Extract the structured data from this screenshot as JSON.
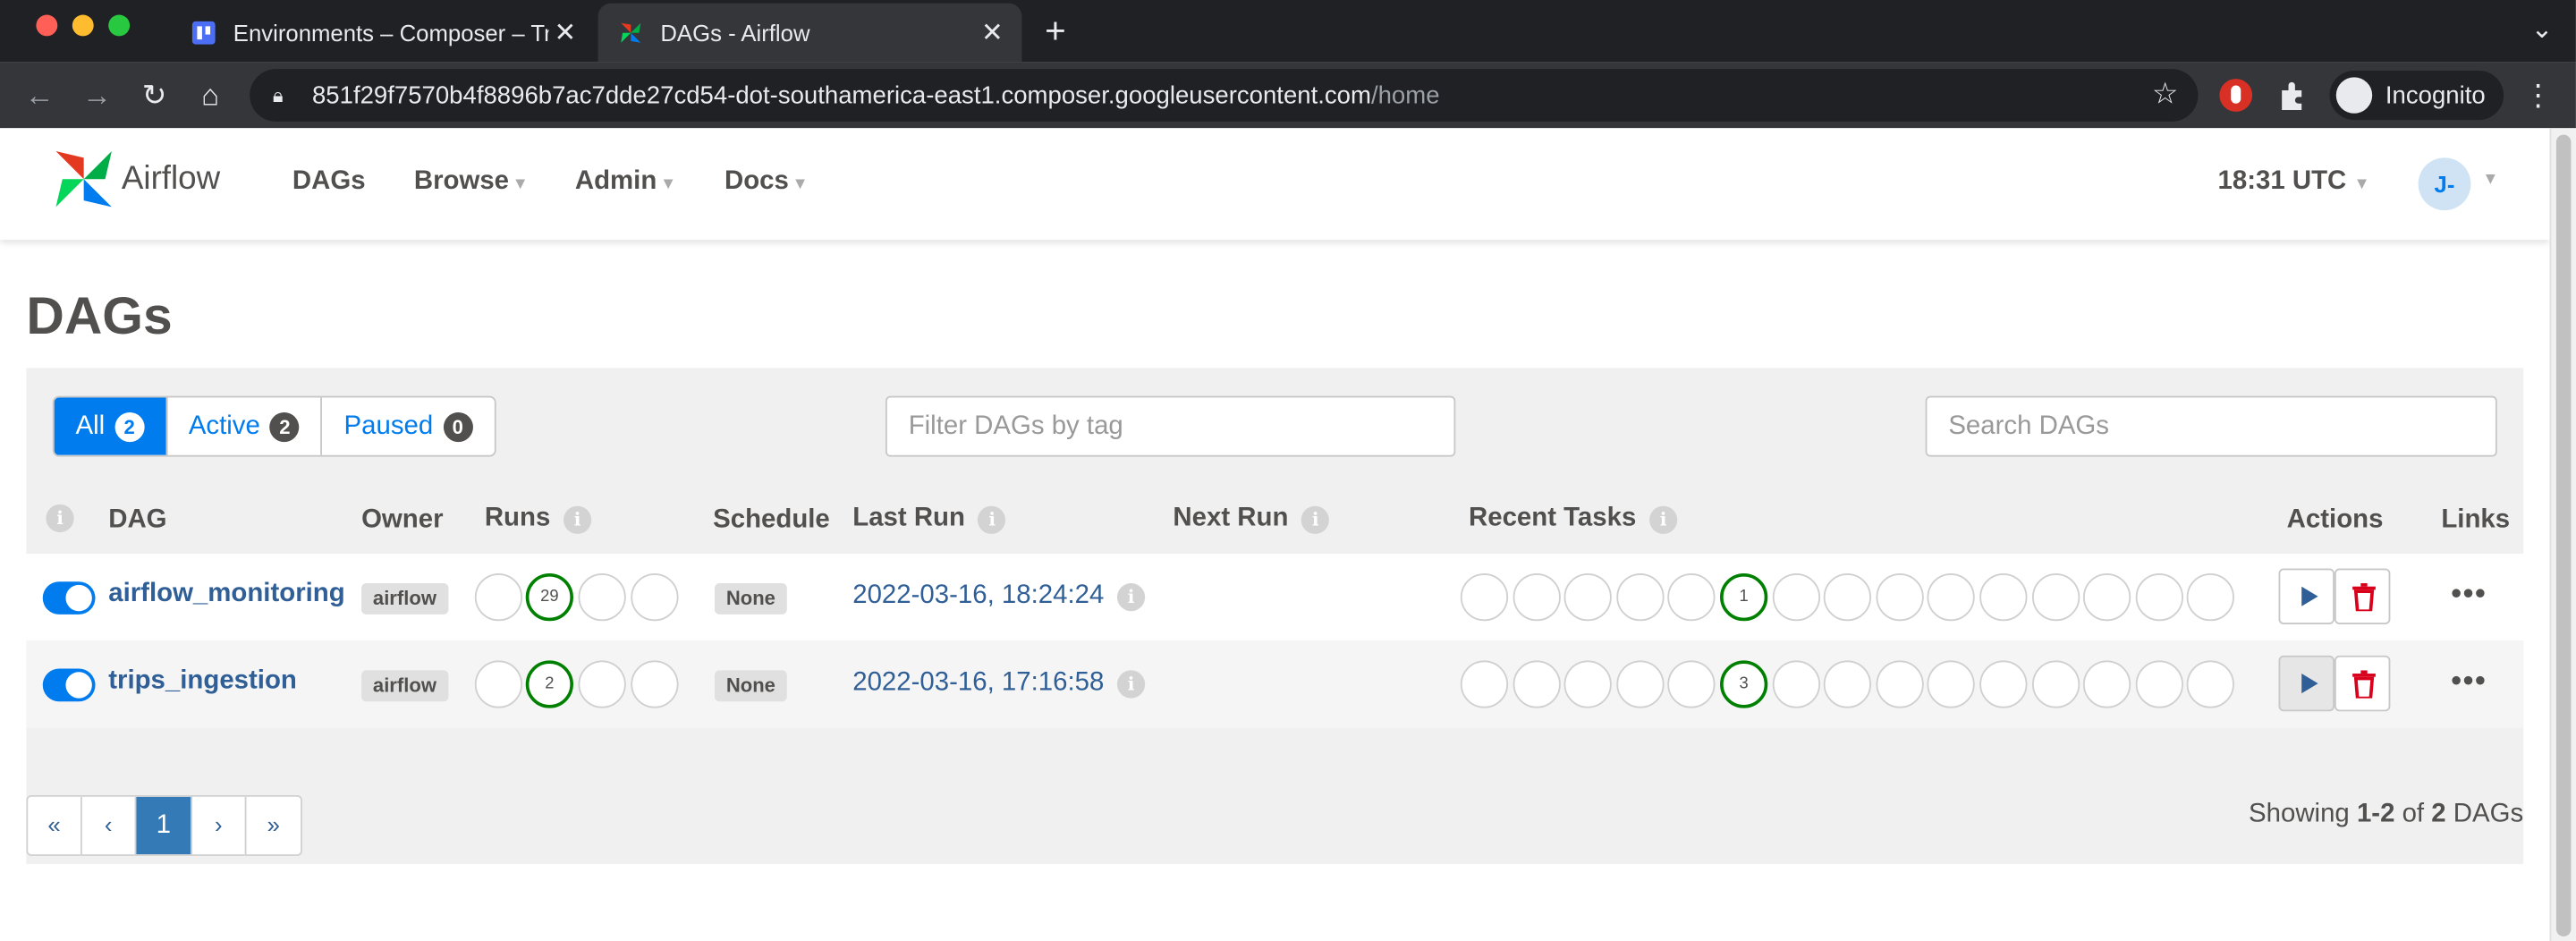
{
  "browser": {
    "tabs": [
      {
        "title": "Environments – Composer – Tr",
        "active": false
      },
      {
        "title": "DAGs - Airflow",
        "active": true
      }
    ],
    "url_host": "851f29f7570b4f8896b7ac7dde27cd54-dot-southamerica-east1.composer.googleusercontent.com",
    "url_path": "/home",
    "profile_label": "Incognito"
  },
  "navbar": {
    "brand": "Airflow",
    "links": [
      "DAGs",
      "Browse",
      "Admin",
      "Docs"
    ],
    "clock": "18:31 UTC",
    "avatar_initials": "J-"
  },
  "page": {
    "title": "DAGs",
    "filters": {
      "all_label": "All",
      "all_count": "2",
      "active_label": "Active",
      "active_count": "2",
      "paused_label": "Paused",
      "paused_count": "0"
    },
    "tag_filter_placeholder": "Filter DAGs by tag",
    "search_placeholder": "Search DAGs",
    "columns": [
      "DAG",
      "Owner",
      "Runs",
      "Schedule",
      "Last Run",
      "Next Run",
      "Recent Tasks",
      "Actions",
      "Links"
    ],
    "rows": [
      {
        "name": "airflow_monitoring",
        "owner": "airflow",
        "runs_success": "29",
        "schedule": "None",
        "last_run": "2022-03-16, 18:24:24",
        "recent_success": "1"
      },
      {
        "name": "trips_ingestion",
        "owner": "airflow",
        "runs_success": "2",
        "schedule": "None",
        "last_run": "2022-03-16, 17:16:58",
        "recent_success": "3"
      }
    ],
    "pagination": {
      "first": "«",
      "prev": "‹",
      "current": "1",
      "next": "›",
      "last": "»"
    },
    "showing": {
      "prefix": "Showing ",
      "range": "1-2",
      "of": " of ",
      "total": "2",
      "suffix": " DAGs"
    }
  },
  "colors": {
    "accent": "#017cee",
    "link": "#2f5f96",
    "success": "#008000",
    "danger": "#d9001b"
  }
}
